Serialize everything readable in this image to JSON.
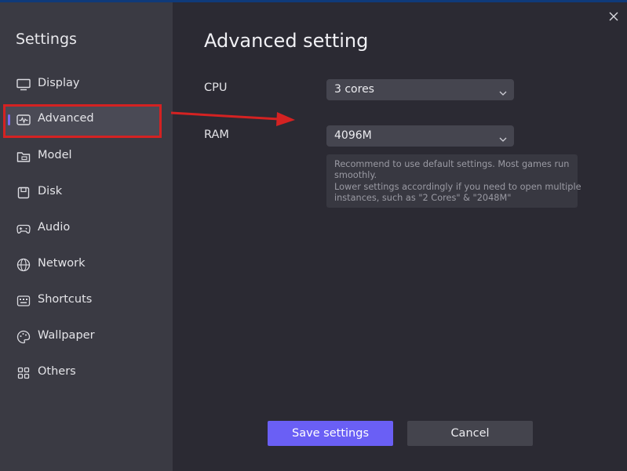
{
  "sidebar": {
    "title": "Settings",
    "items": [
      {
        "label": "Display",
        "icon": "monitor-icon"
      },
      {
        "label": "Advanced",
        "icon": "activity-icon"
      },
      {
        "label": "Model",
        "icon": "folder-icon"
      },
      {
        "label": "Disk",
        "icon": "disk-icon"
      },
      {
        "label": "Audio",
        "icon": "gamepad-icon"
      },
      {
        "label": "Network",
        "icon": "globe-icon"
      },
      {
        "label": "Shortcuts",
        "icon": "keyboard-icon"
      },
      {
        "label": "Wallpaper",
        "icon": "palette-icon"
      },
      {
        "label": "Others",
        "icon": "grid-icon"
      }
    ],
    "active": "Advanced"
  },
  "main": {
    "title": "Advanced setting",
    "cpu": {
      "label": "CPU",
      "value": "3 cores"
    },
    "ram": {
      "label": "RAM",
      "value": "4096M"
    },
    "hint": {
      "line1": "Recommend to use default settings. Most games run",
      "line2": "smoothly.",
      "line3": "Lower settings accordingly if you need to open multiple",
      "line4": "instances, such as \"2 Cores\" & \"2048M\""
    }
  },
  "buttons": {
    "save": "Save settings",
    "cancel": "Cancel"
  },
  "colors": {
    "accent": "#6a5ff5",
    "annotation": "#d42222"
  }
}
